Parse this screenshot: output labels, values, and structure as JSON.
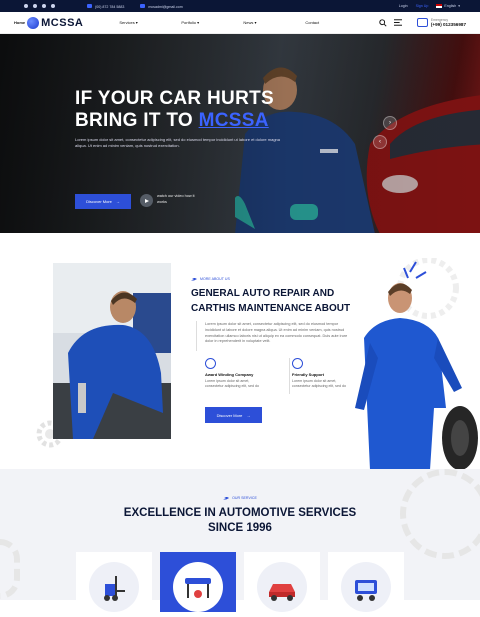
{
  "topbar": {
    "phone": "(00) 872 784 5883",
    "email": "mcsadmi@gmail.com",
    "login": "Login",
    "signup": "Sign Up",
    "language": "English",
    "social_icons": [
      "facebook-icon",
      "instagram-icon",
      "twitter-icon",
      "linkedin-icon"
    ]
  },
  "nav": {
    "home": "Home",
    "logo_text": "MCSSA",
    "menu": [
      "Services ▾",
      "Portfolio ▾",
      "News ▾",
      "Contact"
    ],
    "emergency_label": "Emergency",
    "emergency_phone": "(+99) 012356987"
  },
  "hero": {
    "line1": "IF YOUR CAR HURTS",
    "line2a": "BRING IT TO ",
    "line2b": "MCSSA",
    "desc": "Lorem ipsum dolor sit amet, consectetur adipiscing elit, sed do eiusmod tempor incididunt ut labore et dolore magna aliqua. Ut enim ad minim veniam, quis nostrud exercitation.",
    "cta": "Discover More",
    "watch": "watch our video how it works"
  },
  "about": {
    "subtitle": "MORE ABOUT US",
    "title": "GENERAL AUTO REPAIR AND CARTHIS MAINTENANCE ABOUT",
    "para": "Lorem ipsum dolor sit amet, consectetur adipiscing elit, sed do eiusmod tempor incididunt ut labore et dolore magna aliqua. Ut enim ad minim veniam, quis nostrud exercitation ullamco laboris nisi ut aliquip ex ea commodo consequat. Duis aute irure dolor in reprehenderit in voluptate velit.",
    "feature1_title": "Award Winding Company",
    "feature1_desc": "Lorem ipsum dolor sit amet, consectetur adipiscing elit, sed do",
    "feature2_title": "Friendly Support",
    "feature2_desc": "Lorem ipsum dolor sit amet, consectetur adipiscing elit, sed do",
    "cta": "Discover More"
  },
  "services": {
    "subtitle": "OUR SERVICE",
    "title_line1": "EXCELLENCE IN AUTOMOTIVE SERVICES",
    "title_line2": "SINCE 1996",
    "cards": [
      "forklift-icon",
      "car-lift-icon",
      "car-repair-icon",
      "car-diagnostic-icon"
    ]
  },
  "colors": {
    "accent": "#2d4fd8",
    "dark": "#0b1636"
  }
}
